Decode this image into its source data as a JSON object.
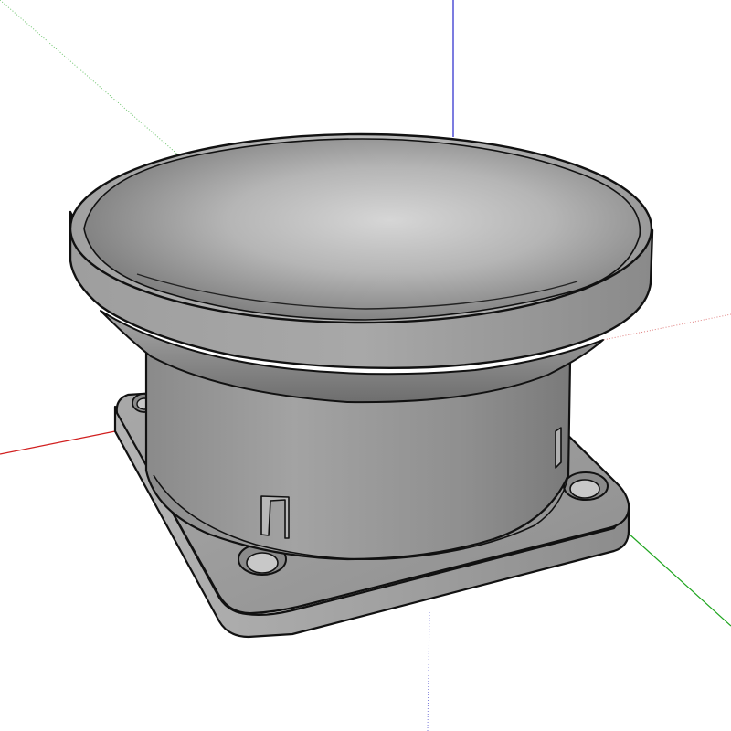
{
  "viewport": {
    "background": "#ffffff",
    "render_style": "shaded-with-edges"
  },
  "axes": {
    "red": "#d11f1f",
    "green": "#1fa51f",
    "blue": "#2626cc"
  },
  "model": {
    "face_color": "#9a9a9a",
    "edge_color": "#111111",
    "mounting_holes": 4
  }
}
